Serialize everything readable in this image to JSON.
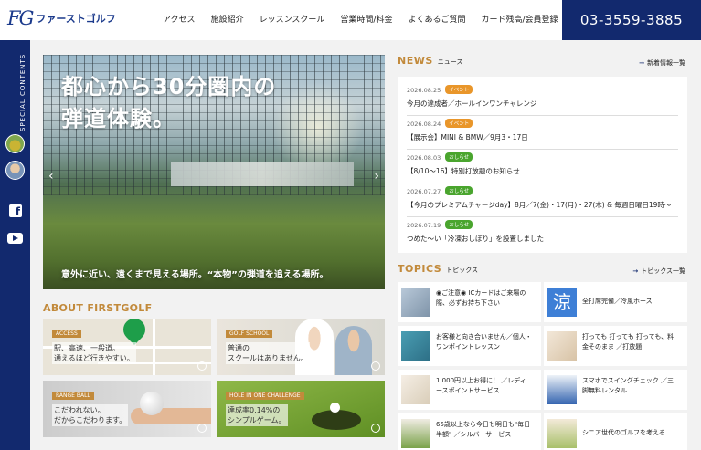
{
  "header": {
    "logo_mark": "FG",
    "logo_text": "ファーストゴルフ",
    "nav": [
      "アクセス",
      "施設紹介",
      "レッスンスクール",
      "営業時間/料金",
      "よくあるご質問",
      "カード残高/会員登録"
    ],
    "phone": "03-3559-3885"
  },
  "sidebar": {
    "label": "SPECIAL CONTENTS",
    "facebook": "f"
  },
  "hero": {
    "title_line1": "都心から30分圏内の",
    "title_line2": "弾道体験。",
    "subtitle": "意外に近い、遠くまで見える場所。“本物”の弾道を追える場所。",
    "prev": "‹",
    "next": "›"
  },
  "about": {
    "heading": "ABOUT FIRSTGOLF",
    "cards": [
      {
        "badge": "ACCESS",
        "line1": "駅、高速、一般道。",
        "line2": "通えるほど行きやすい。"
      },
      {
        "badge": "GOLF SCHOOL",
        "line1": "普通の",
        "line2": "スクールはありません。"
      },
      {
        "badge": "RANGE BALL",
        "line1": "こだわれない。",
        "line2": "だからこだわります。"
      },
      {
        "badge": "HOLE IN ONE CHALLENGE",
        "line1": "達成率0.14%の",
        "line2": "シンプルゲーム。"
      }
    ]
  },
  "news": {
    "en": "NEWS",
    "jp": "ニュース",
    "more": "新着情報一覧",
    "items": [
      {
        "date": "2026.08.25",
        "tag": "イベント",
        "title": "今月の達成者／ホールインワンチャレンジ"
      },
      {
        "date": "2026.08.24",
        "tag": "イベント",
        "title": "【展示会】MINI & BMW／9月3・17日"
      },
      {
        "date": "2026.08.03",
        "tag": "おしらせ",
        "title": "【8/10〜16】特別打放題のお知らせ"
      },
      {
        "date": "2026.07.27",
        "tag": "おしらせ",
        "title": "【今月のプレミアムチャージday】8月／7(金)・17(月)・27(木) & 毎週日曜日19時〜"
      },
      {
        "date": "2026.07.19",
        "tag": "おしらせ",
        "title": "つめた〜い「冷凍おしぼり」を設置しました"
      }
    ]
  },
  "topics": {
    "en": "TOPICS",
    "jp": "トピックス",
    "more": "トピックス一覧",
    "items": [
      {
        "line1": "◉ご注意◉ ICカードはご来場の",
        "line2": "際、必ずお持ち下さい"
      },
      {
        "line1": "全打席完備／冷風ホース",
        "line2": ""
      },
      {
        "line1": "お客様と向き合いません／個人・",
        "line2": "ワンポイントレッスン"
      },
      {
        "line1": "打っても 打っても 打っても、料",
        "line2": "金そのまま ／打放題"
      },
      {
        "line1": "1,000円以上お得に！ ／レディ",
        "line2": "ースポイントサービス"
      },
      {
        "line1": "スマホでスイングチェック ／三",
        "line2": "脚無料レンタル"
      },
      {
        "line1": "65歳以上なら今日も明日も\"毎日",
        "line2": "半額\" ／シルバーサービス"
      },
      {
        "line1": "シニア世代のゴルフを考える",
        "line2": ""
      }
    ],
    "thumb_kanji": "涼"
  },
  "colors": {
    "navy": "#12296e",
    "gold": "#c28a3b",
    "event_tag": "#e9962a",
    "notice_tag": "#4aa52e"
  }
}
